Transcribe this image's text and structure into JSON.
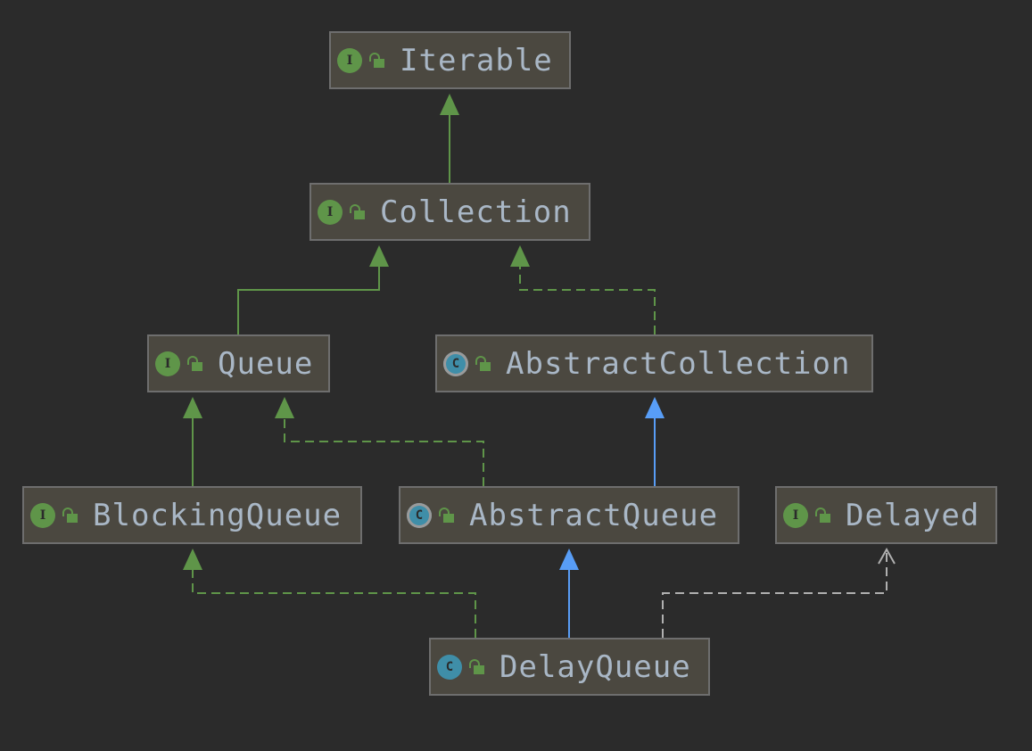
{
  "diagram": {
    "type": "class-hierarchy",
    "nodes": [
      {
        "id": "iterable",
        "label": "Iterable",
        "kind": "interface",
        "kind_glyph": "I",
        "visibility": "public"
      },
      {
        "id": "collection",
        "label": "Collection",
        "kind": "interface",
        "kind_glyph": "I",
        "visibility": "public"
      },
      {
        "id": "queue",
        "label": "Queue",
        "kind": "interface",
        "kind_glyph": "I",
        "visibility": "public"
      },
      {
        "id": "abstract-collection",
        "label": "AbstractCollection",
        "kind": "abstract-class",
        "kind_glyph": "C",
        "visibility": "public"
      },
      {
        "id": "blocking-queue",
        "label": "BlockingQueue",
        "kind": "interface",
        "kind_glyph": "I",
        "visibility": "public"
      },
      {
        "id": "abstract-queue",
        "label": "AbstractQueue",
        "kind": "abstract-class",
        "kind_glyph": "C",
        "visibility": "public"
      },
      {
        "id": "delayed",
        "label": "Delayed",
        "kind": "interface",
        "kind_glyph": "I",
        "visibility": "public"
      },
      {
        "id": "delay-queue",
        "label": "DelayQueue",
        "kind": "class",
        "kind_glyph": "C",
        "visibility": "public"
      }
    ],
    "edges": [
      {
        "from": "collection",
        "to": "iterable",
        "relation": "extends-interface",
        "style": "solid",
        "color": "#5f9549"
      },
      {
        "from": "queue",
        "to": "collection",
        "relation": "extends-interface",
        "style": "solid",
        "color": "#5f9549"
      },
      {
        "from": "abstract-collection",
        "to": "collection",
        "relation": "implements",
        "style": "dashed",
        "color": "#5f9549"
      },
      {
        "from": "blocking-queue",
        "to": "queue",
        "relation": "extends-interface",
        "style": "solid",
        "color": "#5f9549"
      },
      {
        "from": "abstract-queue",
        "to": "queue",
        "relation": "implements",
        "style": "dashed",
        "color": "#5f9549"
      },
      {
        "from": "abstract-queue",
        "to": "abstract-collection",
        "relation": "extends",
        "style": "solid",
        "color": "#589df6"
      },
      {
        "from": "delay-queue",
        "to": "blocking-queue",
        "relation": "implements",
        "style": "dashed",
        "color": "#5f9549"
      },
      {
        "from": "delay-queue",
        "to": "abstract-queue",
        "relation": "extends",
        "style": "solid",
        "color": "#589df6"
      },
      {
        "from": "delay-queue",
        "to": "delayed",
        "relation": "uses",
        "style": "dashed",
        "color": "#b0b0b0"
      }
    ]
  }
}
